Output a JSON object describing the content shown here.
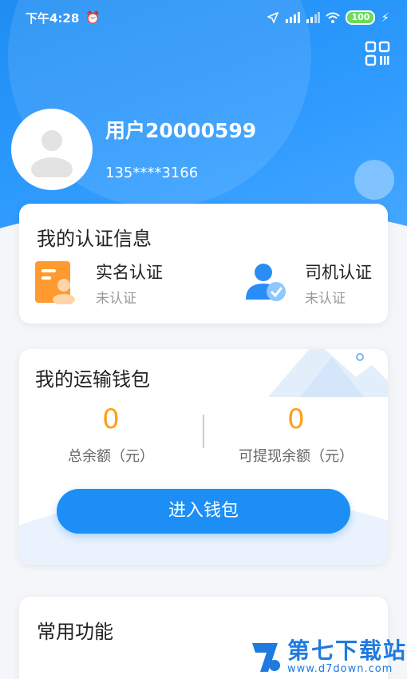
{
  "status_bar": {
    "time": "下午4:28",
    "battery": "100"
  },
  "profile": {
    "username": "用户20000599",
    "phone": "135****3166"
  },
  "auth": {
    "title": "我的认证信息",
    "items": [
      {
        "label": "实名认证",
        "status": "未认证"
      },
      {
        "label": "司机认证",
        "status": "未认证"
      }
    ]
  },
  "wallet": {
    "title": "我的运输钱包",
    "total_value": "0",
    "total_label": "总余额（元）",
    "withdrawable_value": "0",
    "withdrawable_label": "可提现余额（元）",
    "button_label": "进入钱包"
  },
  "functions": {
    "title": "常用功能"
  },
  "watermark": {
    "title": "第七下载站",
    "url": "www.d7down.com"
  },
  "colors": {
    "primary": "#1d8ef5",
    "accent_orange": "#ff9f1a",
    "header": "#2f9bff"
  }
}
